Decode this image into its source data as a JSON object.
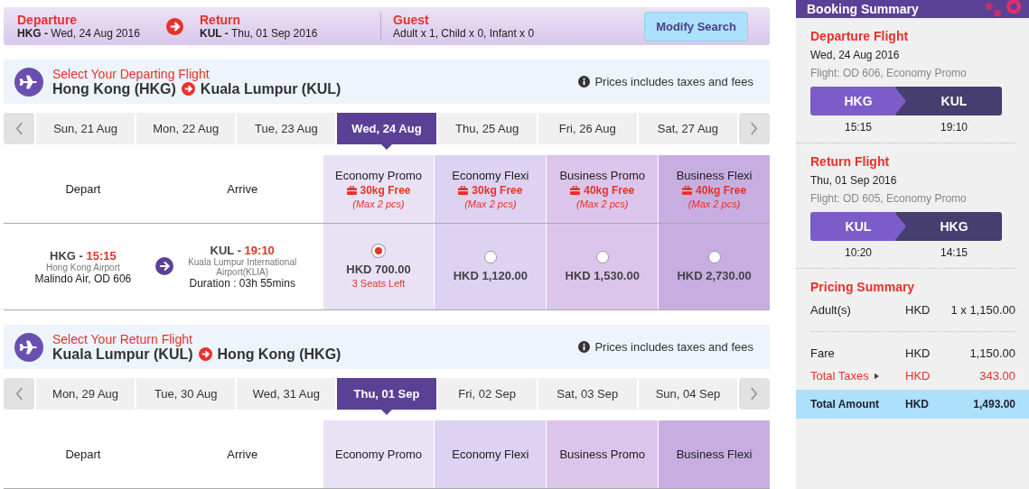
{
  "search_bar": {
    "legs": [
      {
        "label": "Departure",
        "code": "HKG -",
        "date": "Wed, 24 Aug 2016"
      },
      {
        "label": "Return",
        "code": "KUL -",
        "date": "Thu, 01 Sep 2016"
      }
    ],
    "guest": {
      "label": "Guest",
      "value": "Adult x 1, Child x 0, Infant x 0"
    },
    "modify_button": "Modify Search"
  },
  "flights": [
    {
      "title": "Select Your Departing Flight",
      "origin": "Hong Kong (HKG)",
      "destination": "Kuala Lumpur (KUL)",
      "note": "Prices includes taxes and fees",
      "dates": [
        {
          "label": "Sun, 21 Aug",
          "selected": false
        },
        {
          "label": "Mon, 22 Aug",
          "selected": false
        },
        {
          "label": "Tue, 23 Aug",
          "selected": false
        },
        {
          "label": "Wed, 24 Aug",
          "selected": true
        },
        {
          "label": "Thu, 25 Aug",
          "selected": false
        },
        {
          "label": "Fri, 26 Aug",
          "selected": false
        },
        {
          "label": "Sat, 27 Aug",
          "selected": false
        }
      ],
      "depart_heading": "Depart",
      "arrive_heading": "Arrive",
      "fares": [
        {
          "name": "Economy Promo",
          "baggage": "30kg Free",
          "limit": "(Max 2 pcs)"
        },
        {
          "name": "Economy Flexi",
          "baggage": "30kg Free",
          "limit": "(Max 2 pcs)"
        },
        {
          "name": "Business Promo",
          "baggage": "40kg Free",
          "limit": "(Max 2 pcs)"
        },
        {
          "name": "Business Flexi",
          "baggage": "40kg Free",
          "limit": "(Max 2 pcs)"
        }
      ],
      "rows": [
        {
          "from_code": "HKG -",
          "from_time": "15:15",
          "from_airport": "Hong Kong Airport",
          "carrier": "Malindo Air, OD 606",
          "to_code": "KUL -",
          "to_time": "19:10",
          "to_airport": "Kuala Lumpur International Airport(KLIA)",
          "duration": "Duration : 03h 55mins",
          "prices": [
            {
              "amount": "HKD 700.00",
              "seats": "3 Seats Left",
              "selected": true
            },
            {
              "amount": "HKD 1,120.00",
              "selected": false
            },
            {
              "amount": "HKD 1,530.00",
              "selected": false
            },
            {
              "amount": "HKD 2,730.00",
              "selected": false
            }
          ]
        }
      ]
    },
    {
      "title": "Select Your Return Flight",
      "origin": "Kuala Lumpur (KUL)",
      "destination": "Hong Kong (HKG)",
      "note": "Prices includes taxes and fees",
      "dates": [
        {
          "label": "Mon, 29 Aug",
          "selected": false
        },
        {
          "label": "Tue, 30 Aug",
          "selected": false
        },
        {
          "label": "Wed, 31 Aug",
          "selected": false
        },
        {
          "label": "Thu, 01 Sep",
          "selected": true
        },
        {
          "label": "Fri, 02 Sep",
          "selected": false
        },
        {
          "label": "Sat, 03 Sep",
          "selected": false
        },
        {
          "label": "Sun, 04 Sep",
          "selected": false
        }
      ],
      "depart_heading": "Depart",
      "arrive_heading": "Arrive",
      "fares": [
        {
          "name": "Economy Promo"
        },
        {
          "name": "Economy Flexi"
        },
        {
          "name": "Business Promo"
        },
        {
          "name": "Business Flexi"
        }
      ]
    }
  ],
  "summary": {
    "title": "Booking Summary",
    "legs": [
      {
        "heading": "Departure Flight",
        "date": "Wed, 24 Aug 2016",
        "flight": "Flight: OD 606, Economy Promo",
        "from": "HKG",
        "to": "KUL",
        "from_time": "15:15",
        "to_time": "19:10"
      },
      {
        "heading": "Return Flight",
        "date": "Thu, 01 Sep 2016",
        "flight": "Flight: OD 605, Economy Promo",
        "from": "KUL",
        "to": "HKG",
        "from_time": "10:20",
        "to_time": "14:15"
      }
    ],
    "pricing": {
      "title": "Pricing Summary",
      "items": [
        {
          "label": "Adult(s)",
          "currency": "HKD",
          "amount": "1 x 1,150.00"
        }
      ],
      "breakdown": [
        {
          "label": "Fare",
          "currency": "HKD",
          "amount": "1,150.00",
          "kind": "plain"
        },
        {
          "label": "Total Taxes",
          "currency": "HKD",
          "amount": "343.00",
          "kind": "expandable"
        }
      ],
      "total": {
        "label": "Total Amount",
        "currency": "HKD",
        "amount": "1,493.00"
      }
    }
  }
}
